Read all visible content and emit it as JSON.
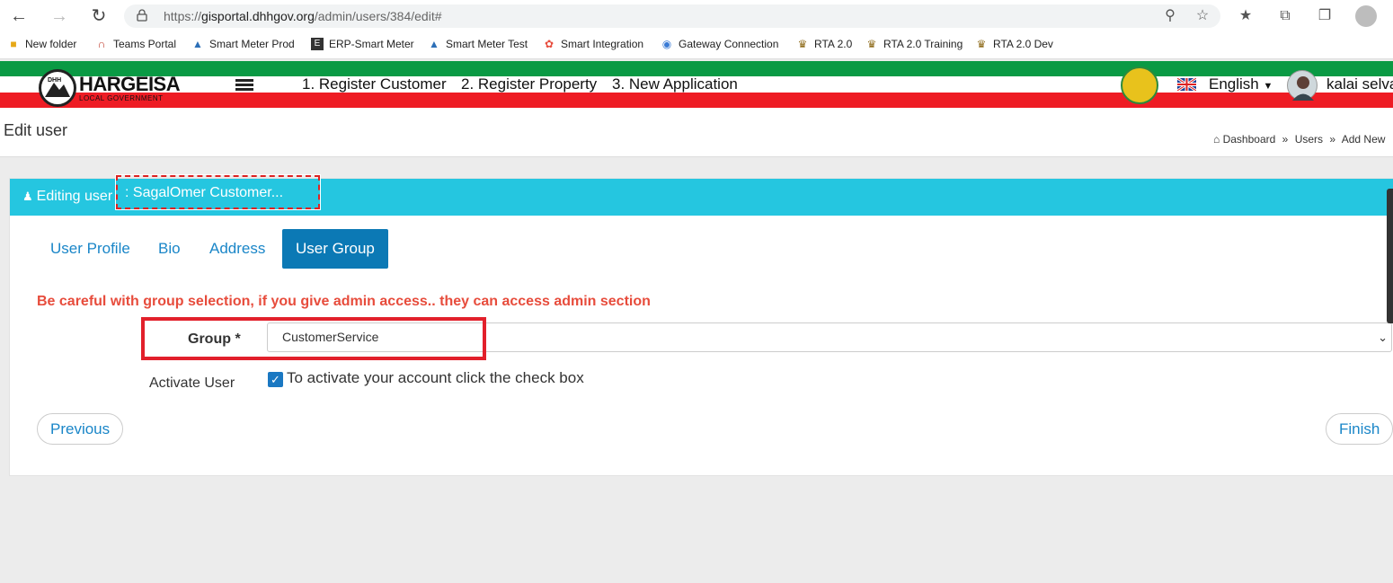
{
  "browser": {
    "url_prefix": "https://",
    "url_host": "gisportal.dhhgov.org",
    "url_path": "/admin/users/384/edit#",
    "icons": [
      "back-icon",
      "forward-icon",
      "refresh-icon",
      "lock-icon",
      "key-icon",
      "favorite-add-icon",
      "favorites-icon",
      "collections-icon",
      "extensions-icon",
      "profile-icon"
    ],
    "bookmarks": [
      {
        "label": "New folder",
        "icon": "folder-icon",
        "color": "#e6a817"
      },
      {
        "label": "Teams Portal",
        "icon": "teams-portal-icon",
        "color": "#c0392b"
      },
      {
        "label": "Smart Meter Prod",
        "icon": "drop-icon",
        "color": "#2c6fb7"
      },
      {
        "label": "ERP-Smart Meter",
        "icon": "erp-icon",
        "color": "#333333"
      },
      {
        "label": "Smart Meter Test",
        "icon": "drop-icon",
        "color": "#2c6fb7"
      },
      {
        "label": "Smart Integration",
        "icon": "integration-icon",
        "color": "#e74c3c"
      },
      {
        "label": "Gateway Connection",
        "icon": "gateway-icon",
        "color": "#3a7bd5"
      },
      {
        "label": "RTA 2.0",
        "icon": "rta-icon",
        "color": "#8e6b1a"
      },
      {
        "label": "RTA 2.0 Training",
        "icon": "rta-icon",
        "color": "#8e6b1a"
      },
      {
        "label": "RTA 2.0 Dev",
        "icon": "rta-icon",
        "color": "#8e6b1a"
      }
    ]
  },
  "app_header": {
    "logo_text": "HARGEISA",
    "logo_sub": "LOCAL GOVERNMENT",
    "logo_mark": "DHH",
    "nav_links": [
      "1. Register Customer",
      "2. Register Property",
      "3. New Application"
    ],
    "language": "English",
    "user_name": "kalai selva",
    "colors": {
      "green": "#0a9a44",
      "red": "#ee1c24"
    }
  },
  "page": {
    "title": "Edit user",
    "breadcrumb": [
      "Dashboard",
      "Users",
      "Add New"
    ],
    "breadcrumb_sep": "»"
  },
  "card": {
    "header_prefix": "Editing user",
    "header_name": ": SagalOmer Customer...",
    "header_color": "#25c6e0",
    "tabs": [
      {
        "label": "User Profile",
        "active": false
      },
      {
        "label": "Bio",
        "active": false
      },
      {
        "label": "Address",
        "active": false
      },
      {
        "label": "User Group",
        "active": true
      }
    ],
    "warning": "Be careful with group selection, if you give admin access.. they can access admin section",
    "group_label": "Group *",
    "group_value": "CustomerService",
    "activate_label": "Activate User",
    "activate_checked": true,
    "activate_text": "To activate your account click the check box",
    "previous_label": "Previous",
    "finish_label": "Finish"
  }
}
